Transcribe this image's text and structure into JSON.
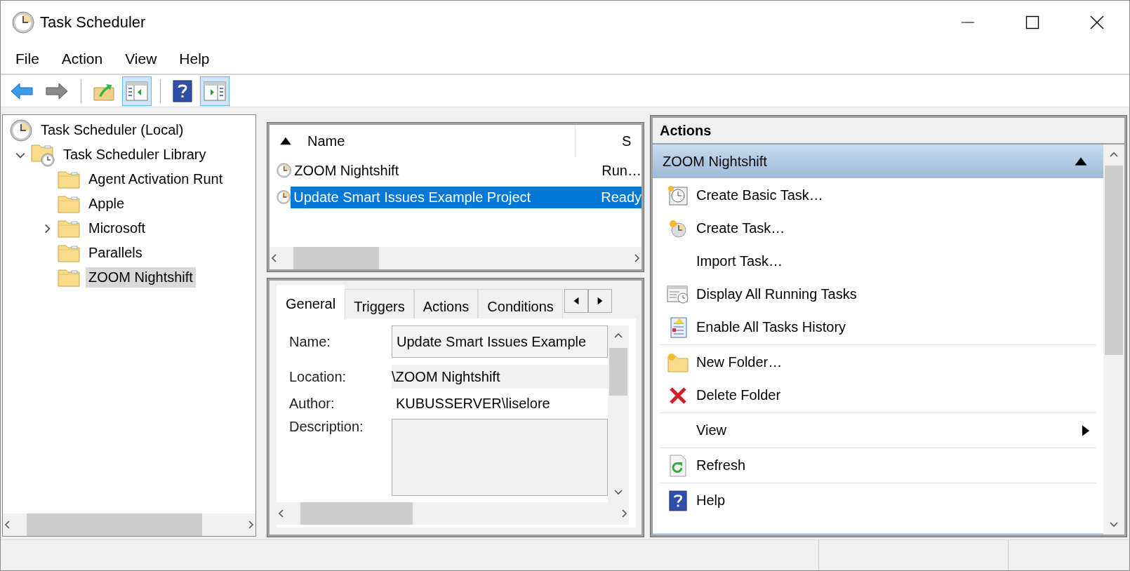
{
  "window": {
    "title": "Task Scheduler"
  },
  "menu": [
    "File",
    "Action",
    "View",
    "Help"
  ],
  "toolbar": [
    {
      "kind": "back",
      "pressed": false
    },
    {
      "kind": "forward",
      "pressed": false
    },
    {
      "kind": "separator"
    },
    {
      "kind": "up-folder",
      "pressed": false
    },
    {
      "kind": "console-tree",
      "pressed": true
    },
    {
      "kind": "separator"
    },
    {
      "kind": "help",
      "pressed": false
    },
    {
      "kind": "action-pane",
      "pressed": true
    }
  ],
  "tree": {
    "items": [
      {
        "label": "Task Scheduler (Local)",
        "kind": "root",
        "selected": false,
        "children": [
          {
            "label": "Task Scheduler Library",
            "kind": "library",
            "expanded": true,
            "selected": false,
            "children": [
              {
                "label": "Agent Activation Runt",
                "kind": "folder",
                "selected": false
              },
              {
                "label": "Apple",
                "kind": "folder",
                "selected": false
              },
              {
                "label": "Microsoft",
                "kind": "folder",
                "expanded": false,
                "selected": false
              },
              {
                "label": "Parallels",
                "kind": "folder",
                "selected": false
              },
              {
                "label": "ZOOM Nightshift",
                "kind": "folder",
                "selected": true
              }
            ]
          }
        ]
      }
    ]
  },
  "task_list": {
    "columns": [
      {
        "label": "Name",
        "sorted": true
      },
      {
        "label": "S",
        "sorted": false
      }
    ],
    "rows": [
      {
        "name": "ZOOM Nightshift",
        "status": "Run…",
        "selected": false
      },
      {
        "name": "Update Smart Issues Example Project",
        "status": "Ready",
        "selected": true
      }
    ]
  },
  "detail": {
    "tabs": [
      {
        "label": "General",
        "selected": true
      },
      {
        "label": "Triggers",
        "selected": false
      },
      {
        "label": "Actions",
        "selected": false
      },
      {
        "label": "Conditions",
        "selected": false
      }
    ],
    "fields": [
      {
        "label": "Name:",
        "kind": "textbox",
        "value": "Update Smart Issues Example"
      },
      {
        "label": "Location:",
        "kind": "readonly",
        "value": "\\ZOOM Nightshift"
      },
      {
        "label": "Author:",
        "kind": "plain",
        "value": "KUBUSSERVER\\liselore"
      },
      {
        "label": "Description:",
        "kind": "textarea"
      }
    ]
  },
  "actions_pane": {
    "title": "Actions",
    "section": {
      "title": "ZOOM Nightshift",
      "expanded": true
    },
    "groups": [
      {
        "items": [
          {
            "label": "Create Basic Task…",
            "kind": "basic-task",
            "submenu": false
          },
          {
            "label": "Create Task…",
            "kind": "create-task",
            "submenu": false
          },
          {
            "label": "Import Task…",
            "kind": "none",
            "submenu": false
          },
          {
            "label": "Display All Running Tasks",
            "kind": "running-tasks",
            "submenu": false
          },
          {
            "label": "Enable All Tasks History",
            "kind": "history",
            "submenu": false
          }
        ]
      },
      {
        "items": [
          {
            "label": "New Folder…",
            "kind": "new-folder",
            "submenu": false
          },
          {
            "label": "Delete Folder",
            "kind": "delete",
            "submenu": false
          }
        ]
      },
      {
        "items": [
          {
            "label": "View",
            "kind": "none",
            "submenu": true
          }
        ]
      },
      {
        "items": [
          {
            "label": "Refresh",
            "kind": "refresh",
            "submenu": false
          }
        ]
      },
      {
        "items": [
          {
            "label": "Help",
            "kind": "help",
            "submenu": false
          }
        ]
      }
    ]
  }
}
